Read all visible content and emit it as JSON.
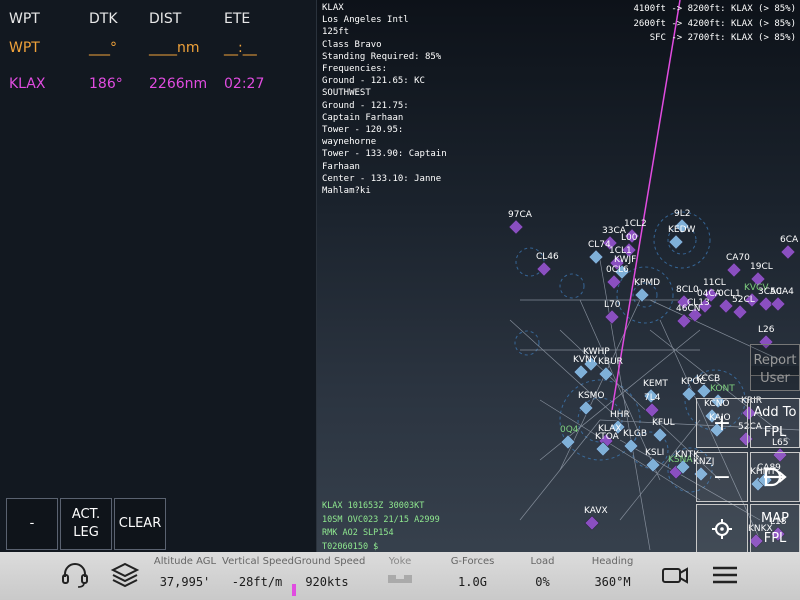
{
  "fpl": {
    "headers": {
      "wpt": "WPT",
      "dtk": "DTK",
      "dist": "DIST",
      "ete": "ETE"
    },
    "edit_row": {
      "wpt": "WPT",
      "dtk": "___°",
      "dist": "____nm",
      "ete": "__:__"
    },
    "rows": [
      {
        "wpt": "KLAX",
        "dtk": "186°",
        "dist": "2266nm",
        "ete": "02:27"
      }
    ],
    "buttons": {
      "minus": "-",
      "act_leg_1": "ACT.",
      "act_leg_2": "LEG",
      "clear": "CLEAR"
    }
  },
  "airport_info": {
    "lines": [
      "KLAX",
      "Los Angeles Intl",
      "125ft",
      "Class Bravo",
      "Standing Required: 85%",
      "Frequencies:",
      "Ground - 121.65: KC",
      "SOUTHWEST",
      "Ground - 121.75:",
      "Captain Farhaan",
      "Tower - 120.95:",
      "waynehorne",
      "Tower - 133.90: Captain",
      "Farhaan",
      "Center - 133.10: Janne",
      "Mahlam?ki"
    ]
  },
  "airspace": [
    "4100ft -> 8200ft: KLAX (> 85%)",
    "2600ft -> 4200ft: KLAX (> 85%)",
    "SFC -> 2700ft: KLAX (> 85%)"
  ],
  "metar": [
    "KLAX 101653Z 30003KT",
    "10SM OVC023 21/15 A2999",
    "RMK AO2 SLP154",
    "T02060150 $"
  ],
  "map_labels": [
    "97CA",
    "9L2",
    "1CL2",
    "33CA",
    "L00",
    "KEDW",
    "CL74",
    "1CL1",
    "KWJF",
    "CL46",
    "0CL6",
    "KPMD",
    "CA70",
    "19CL",
    "6CA",
    "11CL",
    "8CL0",
    "04CA",
    "0CL1",
    "KVCV",
    "3CA0",
    "5CA4",
    "52CL",
    "L70",
    "46CN",
    "CL13",
    "L26",
    "KWHP",
    "KVNY",
    "KBUR",
    "KEMT",
    "7L4",
    "KSMO",
    "KCCB",
    "KPOC",
    "KONT",
    "KCNO",
    "KRIR",
    "KAJO",
    "HHR",
    "KLAX",
    "KTOA",
    "KLGB",
    "KSLI",
    "KFUL",
    "52CA",
    "L65",
    "KHMT",
    "KSNA",
    "KNZJ",
    "CA89",
    "KNTK",
    "0Q4",
    "KAVX",
    "L18",
    "KNKX"
  ],
  "right_buttons": {
    "report": "Report",
    "user": "User",
    "add_to_fpl_1": "Add To",
    "add_to_fpl_2": "FPL",
    "zoom_in": "+",
    "zoom_out": "−",
    "map_fpl_1": "MAP",
    "map_fpl_2": "FPL"
  },
  "status": {
    "altitude_label": "Altitude AGL",
    "altitude": "37,995'",
    "vs_label": "Vertical Speed",
    "vs": "-28ft/m",
    "gs_label": "Ground Speed",
    "gs": "920kts",
    "yoke_label": "Yoke",
    "g_label": "G-Forces",
    "g": "1.0G",
    "load_label": "Load",
    "load": "0%",
    "heading_label": "Heading",
    "heading": "360°M"
  },
  "colors": {
    "accent_magenta": "#e04ce0",
    "edit_orange": "#f0a23a",
    "metar_green": "#8fe88f",
    "airport_blue": "#7fb0d8",
    "airport_purple": "#8a4fc0"
  },
  "icons": [
    "headset-icon",
    "layers-icon",
    "yoke-icon",
    "camera-icon",
    "menu-icon",
    "plus-icon",
    "minus-icon",
    "direct-to-icon",
    "crosshair-icon"
  ]
}
